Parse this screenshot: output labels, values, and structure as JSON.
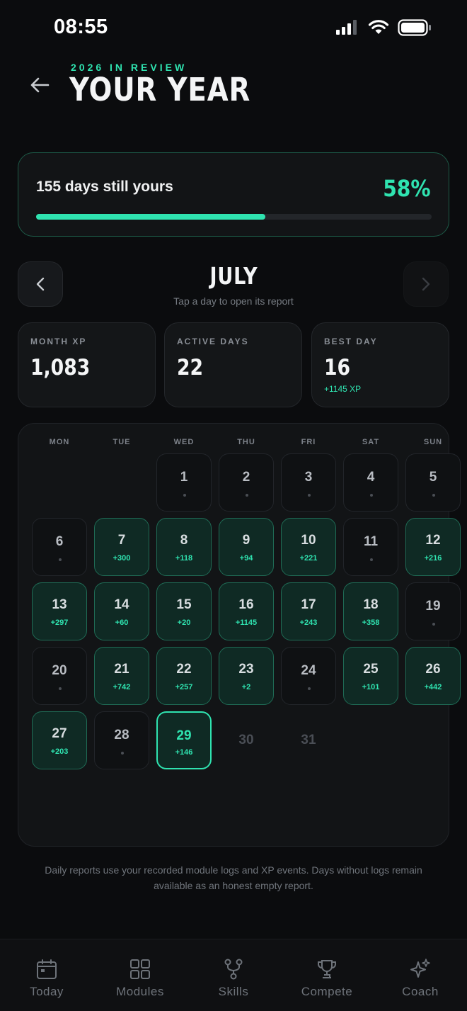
{
  "status": {
    "time": "08:55"
  },
  "header": {
    "kicker": "2026 IN REVIEW",
    "title": "YOUR YEAR"
  },
  "remaining": {
    "text": "155 days still yours",
    "percent_label": "58%",
    "progress": 0.58
  },
  "month": {
    "name": "JULY",
    "hint": "Tap a day to open its report"
  },
  "stats": [
    {
      "label": "MONTH XP",
      "value": "1,083",
      "sub": ""
    },
    {
      "label": "ACTIVE DAYS",
      "value": "22",
      "sub": ""
    },
    {
      "label": "BEST DAY",
      "value": "16",
      "sub": "+1145 XP"
    }
  ],
  "calendar": {
    "weekdays": [
      "MON",
      "TUE",
      "WED",
      "THU",
      "FRI",
      "SAT",
      "SUN"
    ],
    "days": [
      {
        "n": "1",
        "xp": "",
        "state": "empty"
      },
      {
        "n": "2",
        "xp": "",
        "state": "empty"
      },
      {
        "n": "3",
        "xp": "",
        "state": "empty"
      },
      {
        "n": "4",
        "xp": "",
        "state": "empty"
      },
      {
        "n": "5",
        "xp": "",
        "state": "empty"
      },
      {
        "n": "6",
        "xp": "",
        "state": "empty"
      },
      {
        "n": "7",
        "xp": "+300",
        "state": "active"
      },
      {
        "n": "8",
        "xp": "+118",
        "state": "active"
      },
      {
        "n": "9",
        "xp": "+94",
        "state": "active"
      },
      {
        "n": "10",
        "xp": "+221",
        "state": "active"
      },
      {
        "n": "11",
        "xp": "",
        "state": "empty"
      },
      {
        "n": "12",
        "xp": "+216",
        "state": "active"
      },
      {
        "n": "13",
        "xp": "+297",
        "state": "active"
      },
      {
        "n": "14",
        "xp": "+60",
        "state": "active"
      },
      {
        "n": "15",
        "xp": "+20",
        "state": "active"
      },
      {
        "n": "16",
        "xp": "+1145",
        "state": "active"
      },
      {
        "n": "17",
        "xp": "+243",
        "state": "active"
      },
      {
        "n": "18",
        "xp": "+358",
        "state": "active"
      },
      {
        "n": "19",
        "xp": "",
        "state": "empty"
      },
      {
        "n": "20",
        "xp": "",
        "state": "empty"
      },
      {
        "n": "21",
        "xp": "+742",
        "state": "active"
      },
      {
        "n": "22",
        "xp": "+257",
        "state": "active"
      },
      {
        "n": "23",
        "xp": "+2",
        "state": "active"
      },
      {
        "n": "24",
        "xp": "",
        "state": "empty"
      },
      {
        "n": "25",
        "xp": "+101",
        "state": "active"
      },
      {
        "n": "26",
        "xp": "+442",
        "state": "active"
      },
      {
        "n": "27",
        "xp": "+203",
        "state": "active"
      },
      {
        "n": "28",
        "xp": "",
        "state": "empty"
      },
      {
        "n": "29",
        "xp": "+146",
        "state": "selected"
      },
      {
        "n": "30",
        "xp": "",
        "state": "future"
      },
      {
        "n": "31",
        "xp": "",
        "state": "future"
      }
    ]
  },
  "footnote": "Daily reports use your recorded module logs and XP events. Days without logs remain available as an honest empty report.",
  "tabs": [
    {
      "label": "Today",
      "icon": "calendar-icon"
    },
    {
      "label": "Modules",
      "icon": "grid-icon"
    },
    {
      "label": "Skills",
      "icon": "branch-icon"
    },
    {
      "label": "Compete",
      "icon": "trophy-icon"
    },
    {
      "label": "Coach",
      "icon": "sparkles-icon"
    }
  ],
  "colors": {
    "accent": "#2fe3b0",
    "background": "#0b0c0e",
    "card": "#121416"
  }
}
